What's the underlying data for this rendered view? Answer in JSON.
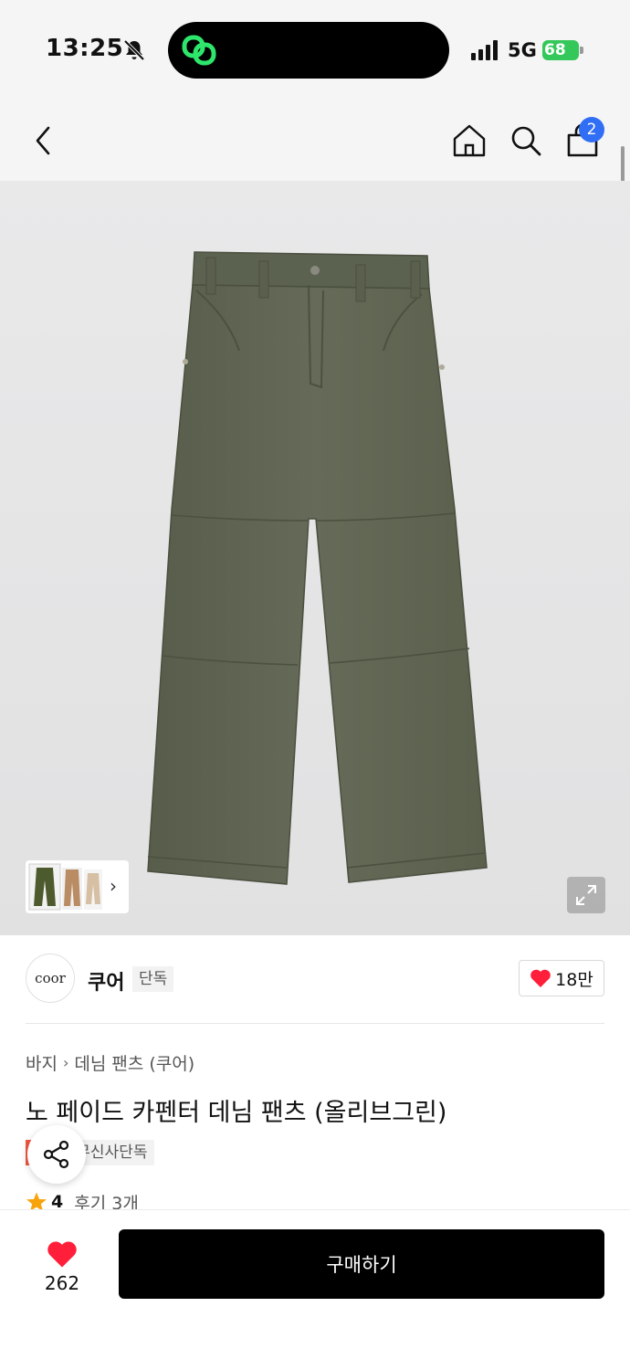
{
  "status_bar": {
    "time": "13:25",
    "network": "5G",
    "battery": "68",
    "icons": [
      "bell-slash-icon",
      "app-link-icon",
      "signal-icon",
      "battery-icon"
    ]
  },
  "nav": {
    "icons": [
      "back-icon",
      "home-icon",
      "search-icon",
      "cart-icon"
    ],
    "cart_count": "2"
  },
  "gallery": {
    "thumbnail_icon": "chevron-right-icon",
    "expand_icon": "expand-icon",
    "colors": {
      "background": "#e7e7e8",
      "product": "#5f6552"
    }
  },
  "brand": {
    "logo_text": "coor",
    "name": "쿠어",
    "tag": "단독",
    "like_count": "18만",
    "like_icon": "heart-icon",
    "like_color": "#ff1f3a"
  },
  "product": {
    "breadcrumb": [
      "바지",
      "데님 팬츠 (쿠어)"
    ],
    "title": "노 페이드 카펜터 데님 팬츠 (올리브그린)",
    "tags": {
      "sale": "세일",
      "exclusive": "무신사단독"
    },
    "rating": "4",
    "review_label": "후기 3개",
    "share_icon": "share-icon",
    "star_color": "#f7a30c"
  },
  "bottom_bar": {
    "wish_count": "262",
    "buy_label": "구매하기"
  }
}
